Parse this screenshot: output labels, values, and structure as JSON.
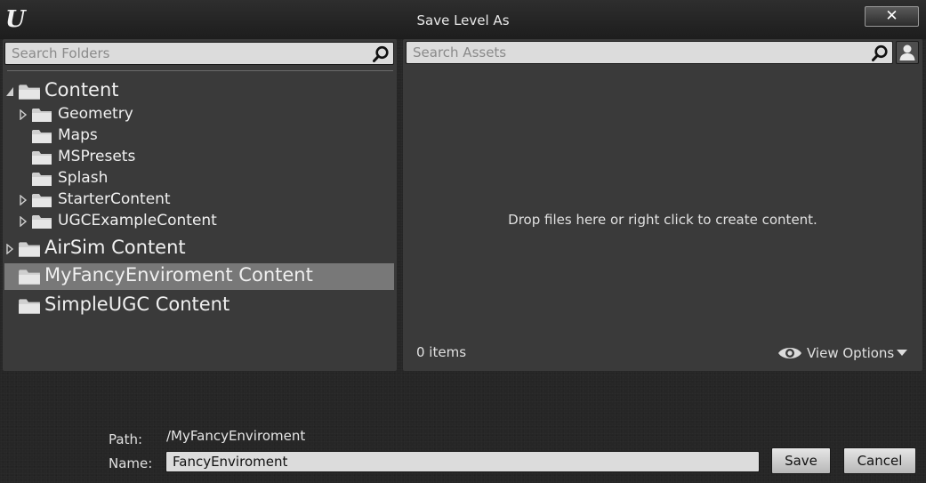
{
  "window": {
    "title": "Save Level As",
    "close_label": "✕"
  },
  "folders": {
    "search_placeholder": "Search Folders",
    "tree": [
      {
        "label": "Content",
        "level": 0,
        "expander": "expanded",
        "selected": false
      },
      {
        "label": "Geometry",
        "level": 1,
        "expander": "collapsed",
        "selected": false
      },
      {
        "label": "Maps",
        "level": 1,
        "expander": "none",
        "selected": false
      },
      {
        "label": "MSPresets",
        "level": 1,
        "expander": "none",
        "selected": false
      },
      {
        "label": "Splash",
        "level": 1,
        "expander": "none",
        "selected": false
      },
      {
        "label": "StarterContent",
        "level": 1,
        "expander": "collapsed",
        "selected": false
      },
      {
        "label": "UGCExampleContent",
        "level": 1,
        "expander": "collapsed",
        "selected": false
      },
      {
        "label": "AirSim Content",
        "level": 0,
        "expander": "collapsed",
        "selected": false
      },
      {
        "label": "MyFancyEnviroment Content",
        "level": 0,
        "expander": "none",
        "selected": true
      },
      {
        "label": "SimpleUGC Content",
        "level": 0,
        "expander": "none",
        "selected": false
      }
    ]
  },
  "assets": {
    "search_placeholder": "Search Assets",
    "empty_message": "Drop files here or right click to create content.",
    "item_count": "0 items",
    "view_options_label": "View Options"
  },
  "footer": {
    "path_label": "Path:",
    "path_value": "/MyFancyEnviroment",
    "name_label": "Name:",
    "name_value": "FancyEnviroment",
    "save_label": "Save",
    "cancel_label": "Cancel"
  },
  "colors": {
    "panel_bg": "#3a3a3a",
    "selected_row": "#787878",
    "input_bg": "#dcdcdc",
    "text": "#e0e0e0"
  }
}
